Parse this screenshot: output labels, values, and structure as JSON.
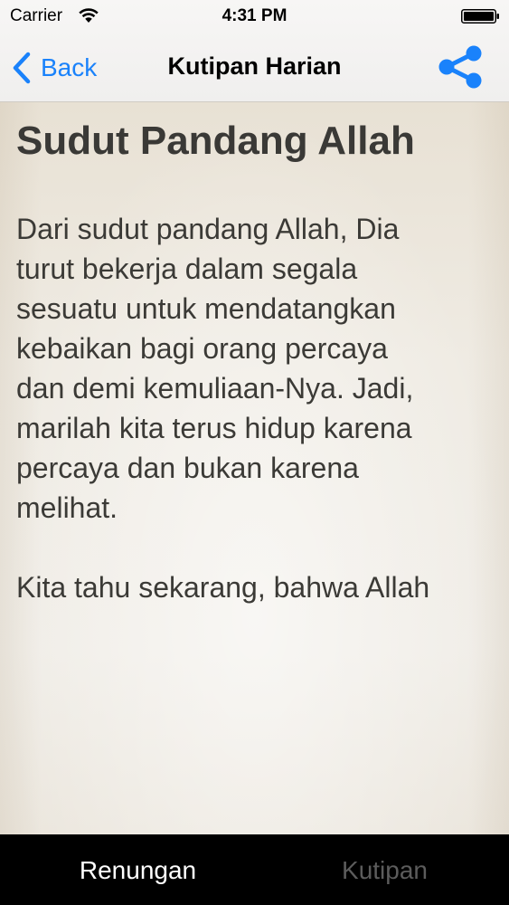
{
  "status_bar": {
    "carrier": "Carrier",
    "time": "4:31 PM",
    "icons": [
      "wifi-icon",
      "battery-icon"
    ]
  },
  "nav": {
    "back_label": "Back",
    "title": "Kutipan Harian",
    "share_icon": "share-icon",
    "accent_color": "#1a82fb"
  },
  "article": {
    "title": "Sudut Pandang Allah",
    "paragraph1_lines": [
      "Dari sudut pandang Allah, Dia",
      "turut bekerja dalam segala",
      "sesuatu untuk mendatangkan",
      "kebaikan bagi orang percaya",
      "dan demi kemuliaan-Nya. Jadi,",
      "marilah kita terus hidup karena",
      "percaya dan bukan karena",
      "melihat."
    ],
    "paragraph2_lines": [
      "Kita tahu sekarang, bahwa Allah"
    ]
  },
  "tabs": [
    {
      "label": "Renungan",
      "active": true
    },
    {
      "label": "Kutipan",
      "active": false
    }
  ]
}
